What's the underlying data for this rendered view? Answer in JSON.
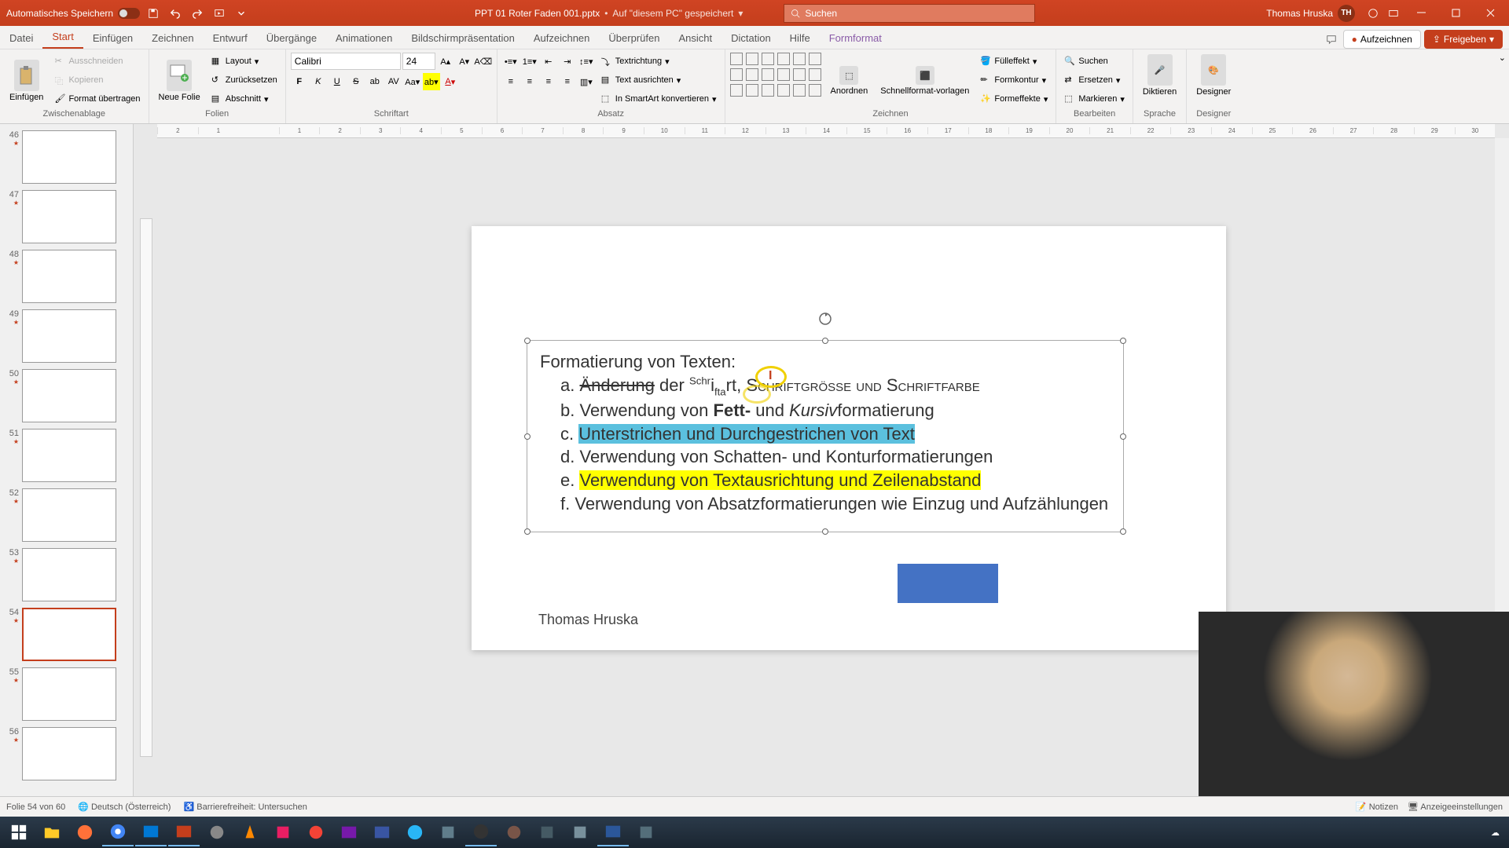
{
  "titlebar": {
    "autosave": "Automatisches Speichern",
    "filename": "PPT 01 Roter Faden 001.pptx",
    "savedHint": "Auf \"diesem PC\" gespeichert",
    "searchPlaceholder": "Suchen",
    "userName": "Thomas Hruska",
    "userInitials": "TH"
  },
  "tabs": {
    "items": [
      "Datei",
      "Start",
      "Einfügen",
      "Zeichnen",
      "Entwurf",
      "Übergänge",
      "Animationen",
      "Bildschirmpräsentation",
      "Aufzeichnen",
      "Überprüfen",
      "Ansicht",
      "Dictation",
      "Hilfe",
      "Formformat"
    ],
    "activeIndex": 1,
    "record": "Aufzeichnen",
    "share": "Freigeben"
  },
  "ribbon": {
    "clipboard": {
      "paste": "Einfügen",
      "cut": "Ausschneiden",
      "copy": "Kopieren",
      "reset": "Zurücksetzen",
      "formatPainter": "Format übertragen",
      "label": "Zwischenablage"
    },
    "slides": {
      "newSlide": "Neue Folie",
      "layout": "Layout",
      "section": "Abschnitt",
      "label": "Folien"
    },
    "font": {
      "name": "Calibri",
      "size": "24",
      "label": "Schriftart"
    },
    "paragraph": {
      "label": "Absatz",
      "textDirection": "Textrichtung",
      "alignText": "Text ausrichten",
      "smartArt": "In SmartArt konvertieren"
    },
    "drawing": {
      "label": "Zeichnen",
      "arrange": "Anordnen",
      "quickStyles": "Schnellformat-vorlagen",
      "fill": "Fülleffekt",
      "outline": "Formkontur",
      "effects": "Formeffekte"
    },
    "editing": {
      "label": "Bearbeiten",
      "find": "Suchen",
      "replace": "Ersetzen",
      "select": "Markieren"
    },
    "voice": {
      "label": "Sprache",
      "dictate": "Diktieren"
    },
    "designer": {
      "label": "Designer",
      "btn": "Designer"
    }
  },
  "ruler": {
    "marks": [
      "2",
      "1",
      "",
      "1",
      "2",
      "3",
      "4",
      "5",
      "6",
      "7",
      "8",
      "9",
      "10",
      "11",
      "12",
      "13",
      "14",
      "15",
      "16",
      "17",
      "18",
      "19",
      "20",
      "21",
      "22",
      "23",
      "24",
      "25",
      "26",
      "27",
      "28",
      "29",
      "30"
    ]
  },
  "thumbnails": [
    {
      "num": "46"
    },
    {
      "num": "47"
    },
    {
      "num": "48"
    },
    {
      "num": "49"
    },
    {
      "num": "50"
    },
    {
      "num": "51"
    },
    {
      "num": "52"
    },
    {
      "num": "53"
    },
    {
      "num": "54",
      "selected": true
    },
    {
      "num": "55"
    },
    {
      "num": "56"
    }
  ],
  "slide": {
    "title": "Formatierung von Texten:",
    "items": [
      {
        "letter": "a.",
        "prefix": "",
        "strike": "Änderung",
        "mid": " der ",
        "script": "Schriftart",
        "rest": ", ",
        "caps": "Schriftgröße und Schriftfarbe"
      },
      {
        "letter": "b.",
        "html": "Verwendung von Fett- und Kursivformatierung"
      },
      {
        "letter": "c.",
        "highlight": "blue",
        "text": "Unterstrichen und Durchgestrichen von Text"
      },
      {
        "letter": "d.",
        "html": "Verwendung von Schatten- und Konturformatierungen"
      },
      {
        "letter": "e.",
        "highlight": "yellow",
        "text": "Verwendung von Textausrichtung und Zeilenabstand"
      },
      {
        "letter": "f.",
        "html": "Verwendung von Absatzformatierungen wie Einzug und Aufzählungen"
      }
    ],
    "author": "Thomas Hruska"
  },
  "status": {
    "slideCount": "Folie 54 von 60",
    "language": "Deutsch (Österreich)",
    "accessibility": "Barrierefreiheit: Untersuchen",
    "notes": "Notizen",
    "display": "Anzeigeeinstellungen"
  }
}
